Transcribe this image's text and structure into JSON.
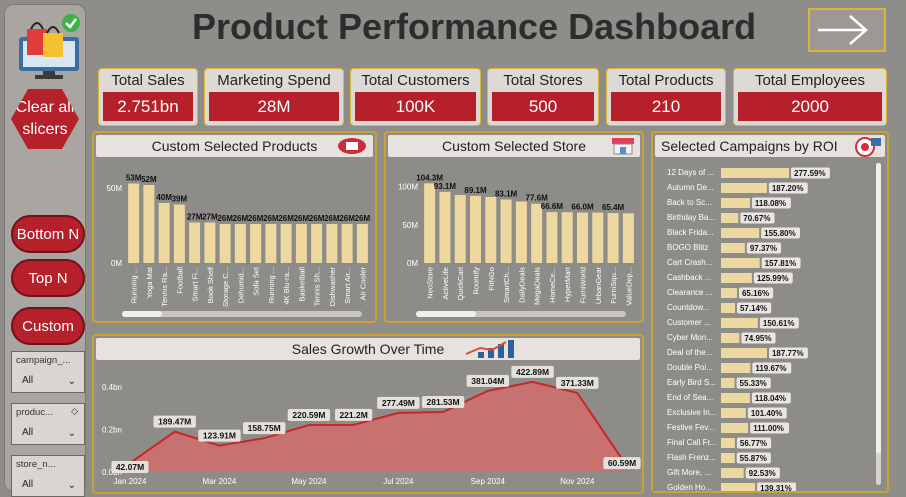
{
  "dashboard": {
    "title": "Product Performance Dashboard",
    "colors": {
      "accent": "#b5202b",
      "bar": "#edd9a0",
      "gold": "#d9b53a",
      "area": "#d96a6a"
    }
  },
  "sidebar": {
    "clear_label": "Clear all slicers",
    "bottom_label": "Bottom N",
    "top_label": "Top N",
    "custom_label": "Custom",
    "slicers": [
      {
        "label": "campaign_...",
        "value": "All"
      },
      {
        "label": "produc...",
        "value": "All"
      },
      {
        "label": "store_n...",
        "value": "All"
      }
    ]
  },
  "kpis": [
    {
      "label": "Total Sales",
      "value": "2.751bn"
    },
    {
      "label": "Marketing Spend",
      "value": "28M"
    },
    {
      "label": "Total Customers",
      "value": "100K"
    },
    {
      "label": "Total Stores",
      "value": "500"
    },
    {
      "label": "Total Products",
      "value": "210"
    },
    {
      "label": "Total Employees",
      "value": "2000"
    }
  ],
  "chart_data": [
    {
      "type": "bar",
      "title": "Custom Selected Products",
      "categories": [
        "Running ...",
        "Yoga Mat",
        "Tennis Ra...",
        "Football",
        "Smart Fi...",
        "Book Shelf",
        "Storage C...",
        "Dehumid...",
        "Sofa Set",
        "Running ...",
        "4K Blu-ra...",
        "Basketball",
        "Tennis Sh...",
        "Dishwasher",
        "Smart Air...",
        "Air Cooler"
      ],
      "values": [
        53,
        52,
        40,
        39,
        27,
        27,
        26,
        26,
        26,
        26,
        26,
        26,
        26,
        26,
        26,
        26
      ],
      "data_labels": [
        "53M",
        "52M",
        "40M",
        "39M",
        "27M",
        "27M",
        "26M",
        "26M",
        "26M",
        "26M",
        "26M",
        "26M",
        "26M",
        "26M",
        "26M",
        "26M"
      ],
      "y_ticks": [
        "0M",
        "50M"
      ],
      "ylim": [
        0,
        60
      ]
    },
    {
      "type": "bar",
      "title": "Custom Selected Store",
      "categories": [
        "NeoStore",
        "ActiveLife",
        "QuickCart",
        "Roomify",
        "FitNGo",
        "SmartCh...",
        "DailyDeals",
        "MegaDeals",
        "HomeCe...",
        "HyperMart",
        "FurniWorld",
        "UrbanGear",
        "FurniSqu...",
        "ValueDep..."
      ],
      "values": [
        104.3,
        93.1,
        89.1,
        88.0,
        86.5,
        83.1,
        80.5,
        77.6,
        66.6,
        66.5,
        66.0,
        66.0,
        65.4,
        65.0
      ],
      "data_labels": [
        "104.3M",
        "93.1M",
        "",
        "89.1M",
        "",
        "83.1M",
        "",
        "77.6M",
        "66.6M",
        "",
        "66.0M",
        "",
        "65.4M",
        ""
      ],
      "y_ticks": [
        "0M",
        "50M",
        "100M"
      ],
      "ylim": [
        0,
        110
      ]
    },
    {
      "type": "bar",
      "orientation": "horizontal",
      "title": "Selected Campaigns by ROI",
      "categories": [
        "12 Days of ...",
        "Autumn De...",
        "Back to Sc...",
        "Birthday Ba...",
        "Black Frida...",
        "BOGO Blitz",
        "Cart Crash...",
        "Cashback ...",
        "Clearance ...",
        "Countdow...",
        "Customer ...",
        "Cyber Mon...",
        "Deal of the...",
        "Double Poi...",
        "Early Bird S...",
        "End of Sea...",
        "Exclusive In...",
        "Festive Fev...",
        "Final Call Fr...",
        "Flash Frenz...",
        "Gift More, ...",
        "Golden Ho..."
      ],
      "values": [
        277.59,
        187.2,
        118.08,
        70.67,
        155.8,
        97.37,
        157.81,
        125.99,
        65.16,
        57.14,
        150.61,
        74.95,
        187.77,
        119.67,
        55.33,
        118.04,
        101.4,
        111.0,
        56.77,
        55.87,
        92.53,
        139.31
      ],
      "data_labels": [
        "277.59%",
        "187.20%",
        "118.08%",
        "70.67%",
        "155.80%",
        "97.37%",
        "157.81%",
        "125.99%",
        "65.16%",
        "57.14%",
        "150.61%",
        "74.95%",
        "187.77%",
        "119.67%",
        "55.33%",
        "118.04%",
        "101.40%",
        "111.00%",
        "56.77%",
        "55.87%",
        "92.53%",
        "139.31%"
      ]
    },
    {
      "type": "area",
      "title": "Sales Growth Over Time",
      "x": [
        "Jan 2024",
        "Feb 2024",
        "Mar 2024",
        "Apr 2024",
        "May 2024",
        "Jun 2024",
        "Jul 2024",
        "Aug 2024",
        "Sep 2024",
        "Oct 2024",
        "Nov 2024",
        "Dec 2024"
      ],
      "values": [
        42.07,
        189.47,
        123.91,
        158.75,
        220.59,
        221.2,
        277.49,
        281.53,
        381.04,
        422.89,
        371.33,
        60.59
      ],
      "data_labels": [
        "42.07M",
        "189.47M",
        "123.91M",
        "158.75M",
        "220.59M",
        "221.2M",
        "277.49M",
        "281.53M",
        "381.04M",
        "422.89M",
        "371.33M",
        "60.59M"
      ],
      "x_tick_labels": [
        "Jan 2024",
        "Mar 2024",
        "May 2024",
        "Jul 2024",
        "Sep 2024",
        "Nov 2024"
      ],
      "y_ticks": [
        "0.0bn",
        "0.2bn",
        "0.4bn"
      ],
      "ylim": [
        0,
        460
      ]
    }
  ]
}
